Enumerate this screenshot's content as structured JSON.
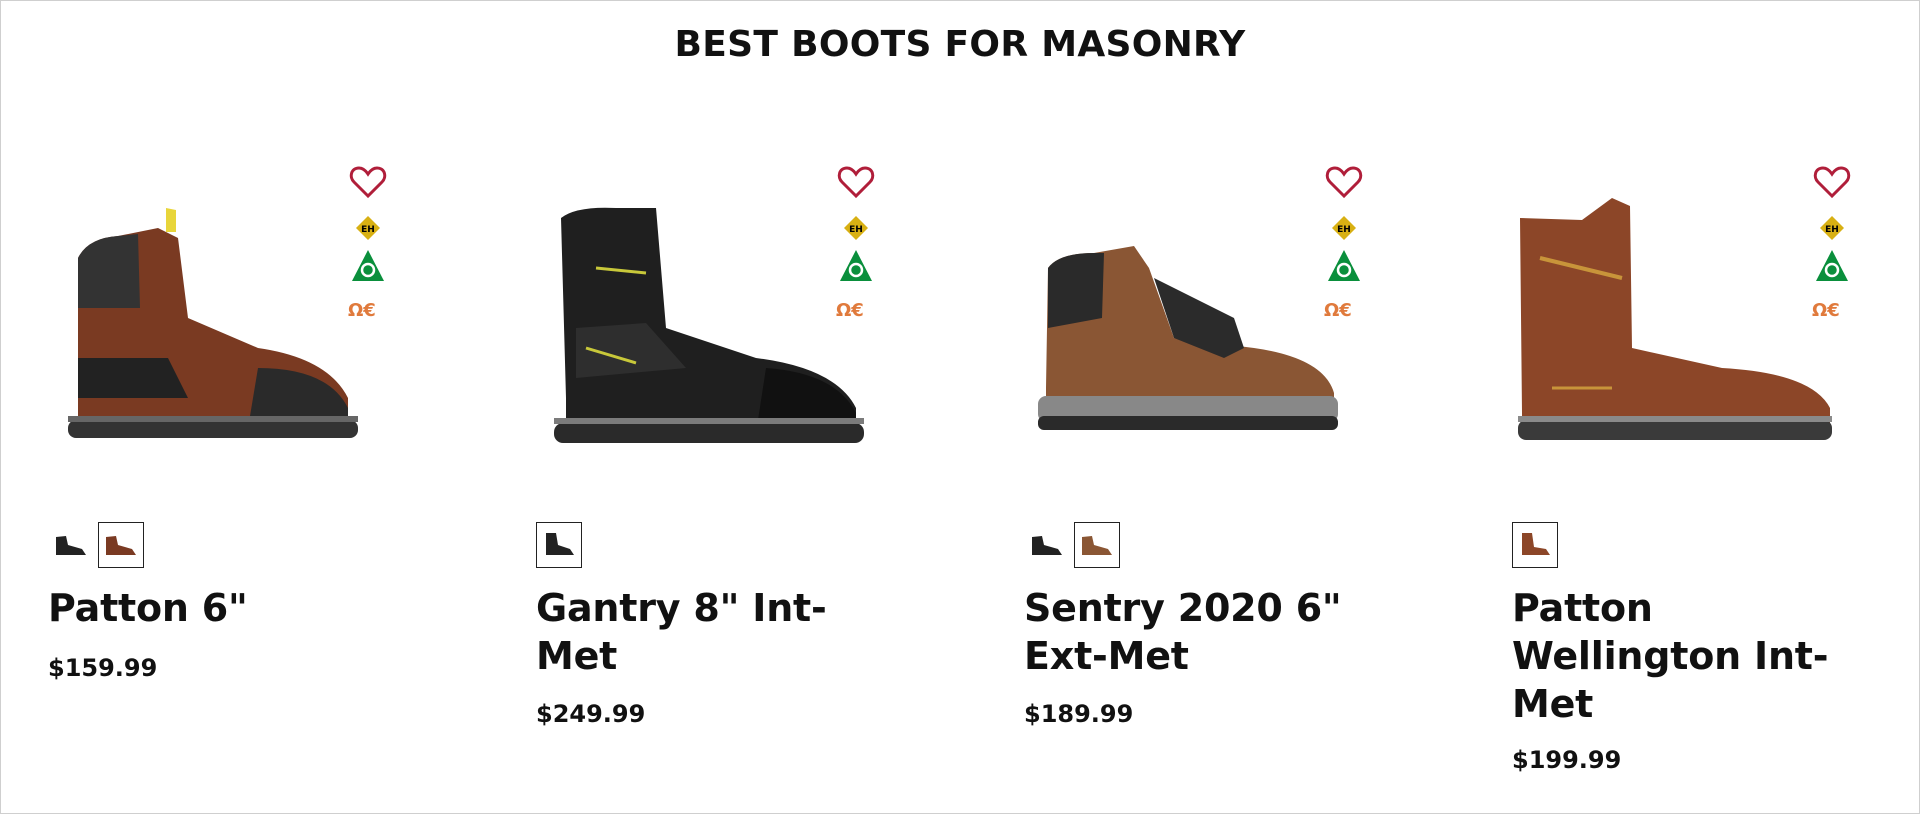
{
  "section": {
    "title": "BEST BOOTS FOR MASONRY"
  },
  "colors": {
    "heart": "#b01e3a",
    "csa_green": "#0a8f3c",
    "esr_orange": "#e07a3c",
    "badge_yellow": "#d8b013"
  },
  "products": [
    {
      "name": "Patton 6\"",
      "price": "$159.99",
      "swatches": [
        "black",
        "brown"
      ],
      "selected_swatch": 1,
      "boot_color": "brown",
      "badges": {
        "omega_text": "Ω€"
      }
    },
    {
      "name": "Gantry 8\" Int-Met",
      "price": "$249.99",
      "swatches": [
        "black"
      ],
      "selected_swatch": 0,
      "boot_color": "black",
      "badges": {
        "omega_text": "Ω€"
      }
    },
    {
      "name": "Sentry 2020 6\" Ext-Met",
      "price": "$189.99",
      "swatches": [
        "black",
        "brown"
      ],
      "selected_swatch": 1,
      "boot_color": "tan",
      "badges": {
        "omega_text": "Ω€"
      }
    },
    {
      "name": "Patton Wellington Int-Met",
      "price": "$199.99",
      "swatches": [
        "brown"
      ],
      "selected_swatch": 0,
      "boot_color": "brown",
      "badges": {
        "omega_text": "Ω€"
      }
    }
  ]
}
